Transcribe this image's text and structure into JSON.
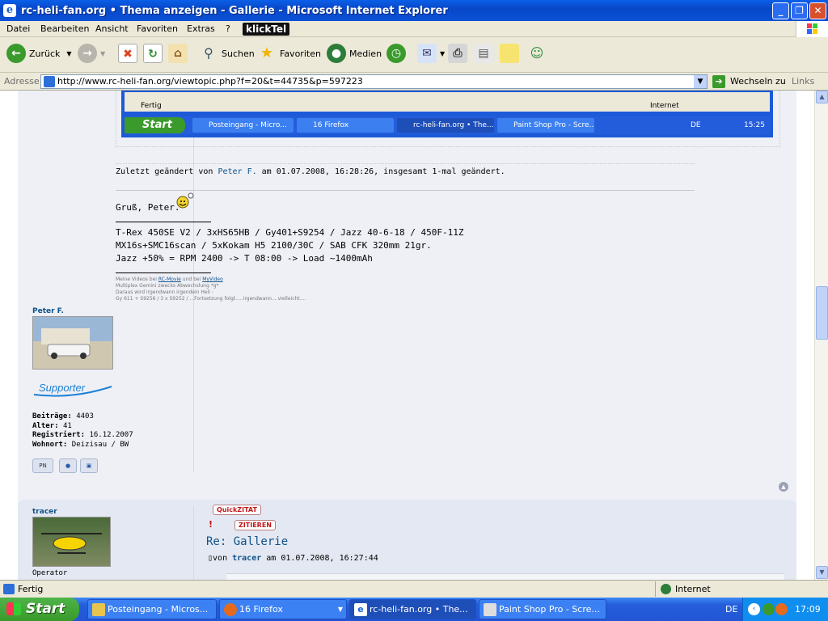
{
  "window": {
    "title": "rc-heli-fan.org • Thema anzeigen - Gallerie - Microsoft Internet Explorer",
    "controls": [
      "_",
      "❐",
      "✕"
    ]
  },
  "menu": [
    "Datei",
    "Bearbeiten",
    "Ansicht",
    "Favoriten",
    "Extras",
    "?"
  ],
  "menu_brand": "klickTel",
  "toolbar": {
    "back": "Zurück",
    "search": "Suchen",
    "favorites": "Favoriten",
    "media": "Medien"
  },
  "address": {
    "label": "Adresse",
    "url": "http://www.rc-heli-fan.org/viewtopic.php?f=20&t=44735&p=597223",
    "go": "Wechseln zu",
    "links": "Links"
  },
  "embedded": {
    "status_left": "Fertig",
    "status_right": "Internet",
    "start": "Start",
    "tasks": [
      "Posteingang - Micro...",
      "16 Firefox",
      "rc-heli-fan.org • The...",
      "Paint Shop Pro - Scre..."
    ],
    "lang": "DE",
    "clock": "15:25"
  },
  "post1": {
    "edited_prefix": "Zuletzt geändert von",
    "edited_user": "Peter F.",
    "edited_suffix": "am 01.07.2008, 16:28:26, insgesamt 1-mal geändert.",
    "greeting": "Gruß, Peter.",
    "sig_lines": [
      "T-Rex 450SE V2 / 3xHS65HB / Gy401+S9254 / Jazz 40-6-18 / 450F-11Z",
      "MX16s+SMC16scan / 5xKokam H5 2100/30C / SAB CFK 320mm 21gr.",
      "Jazz +50% = RPM 2400 -> T 08:00 -> Load ~1400mAh"
    ],
    "small_line1_prefix": "Meine Videos bei",
    "small_line1_link1": "RC-Movie",
    "small_line1_mid": "und bei",
    "small_line1_link2": "MyVideo",
    "small_lines": [
      "Multiplex Gemini zwecks Abwechslung *g*",
      "Daraus wird irgendwann irgendein Heli :",
      "Gy 611 + S9256 / 3 x S9252 / ...Fortsetzung folgt.....irgendwann....vielleicht...."
    ],
    "user": {
      "name": "Peter F.",
      "rank": "Supporter",
      "stats": [
        {
          "label": "Beiträge:",
          "value": "4403"
        },
        {
          "label": "Alter:",
          "value": "41"
        },
        {
          "label": "Registriert:",
          "value": "16.12.2007"
        },
        {
          "label": "Wohnort:",
          "value": "Deizisau / BW"
        }
      ],
      "buttons": [
        "PN",
        "www",
        "icq"
      ]
    }
  },
  "post2": {
    "user": "tracer",
    "rank": "Operator",
    "quick_quote": "QuickZITAT",
    "quote": "ZITIEREN",
    "warn": "!",
    "subject": "Re: Gallerie",
    "by_prefix": "von",
    "by_user": "tracer",
    "by_date": "am 01.07.2008, 16:27:44"
  },
  "statusbar": {
    "left": "Fertig",
    "right": "Internet"
  },
  "taskbar": {
    "start": "Start",
    "tasks": [
      {
        "label": "Posteingang - Micros...",
        "active": false
      },
      {
        "label": "16 Firefox",
        "active": false
      },
      {
        "label": "rc-heli-fan.org • The...",
        "active": true
      },
      {
        "label": "Paint Shop Pro - Scre...",
        "active": false
      }
    ],
    "lang": "DE",
    "clock": "17:09"
  }
}
